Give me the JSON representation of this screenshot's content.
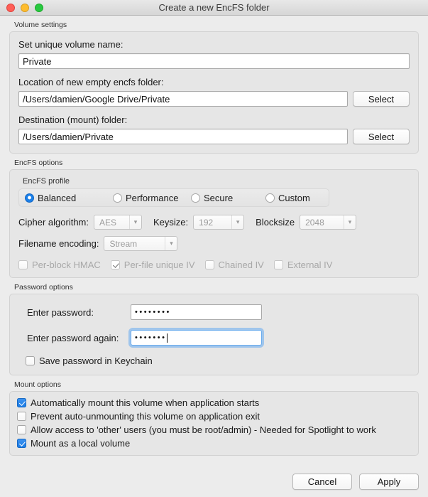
{
  "window": {
    "title": "Create a new EncFS folder",
    "traffic_lights": [
      "close-button",
      "minimize-button",
      "zoom-button"
    ],
    "accent_color": "#1c7de6"
  },
  "volume_settings": {
    "section_label": "Volume settings",
    "name_label": "Set unique volume name:",
    "name_value": "Private",
    "name_placeholder": "",
    "location_label": "Location of new empty encfs folder:",
    "location_value": "/Users/damien/Google Drive/Private",
    "location_select_button": "Select",
    "destination_label": "Destination (mount) folder:",
    "destination_value": "/Users/damien/Private",
    "destination_select_button": "Select"
  },
  "encfs_options": {
    "section_label": "EncFS options",
    "profile_label": "EncFS profile",
    "profiles": [
      {
        "label": "Balanced",
        "selected": true
      },
      {
        "label": "Performance",
        "selected": false
      },
      {
        "label": "Secure",
        "selected": false
      },
      {
        "label": "Custom",
        "selected": false
      }
    ],
    "cipher_label": "Cipher algorithm:",
    "cipher_value": "AES",
    "keysize_label": "Keysize:",
    "keysize_value": "192",
    "blocksize_label": "Blocksize",
    "blocksize_value": "2048",
    "encoding_label": "Filename encoding:",
    "encoding_value": "Stream",
    "flags": [
      {
        "label": "Per-block HMAC",
        "checked": false,
        "disabled": true
      },
      {
        "label": "Per-file unique IV",
        "checked": true,
        "disabled": true
      },
      {
        "label": "Chained IV",
        "checked": false,
        "disabled": true
      },
      {
        "label": "External IV",
        "checked": false,
        "disabled": true
      }
    ]
  },
  "password_options": {
    "section_label": "Password options",
    "enter_label": "Enter password:",
    "enter_value": "••••••••",
    "again_label": "Enter password again:",
    "again_value": "•••••••",
    "keychain_label": "Save password in Keychain",
    "keychain_checked": false
  },
  "mount_options": {
    "section_label": "Mount options",
    "items": [
      {
        "label": "Automatically mount this volume when application starts",
        "checked": true
      },
      {
        "label": "Prevent auto-unmounting this volume on application exit",
        "checked": false
      },
      {
        "label": "Allow access to 'other' users (you must be root/admin) - Needed for Spotlight to work",
        "checked": false
      },
      {
        "label": "Mount as a local volume",
        "checked": true
      }
    ]
  },
  "footer": {
    "cancel_label": "Cancel",
    "apply_label": "Apply"
  }
}
